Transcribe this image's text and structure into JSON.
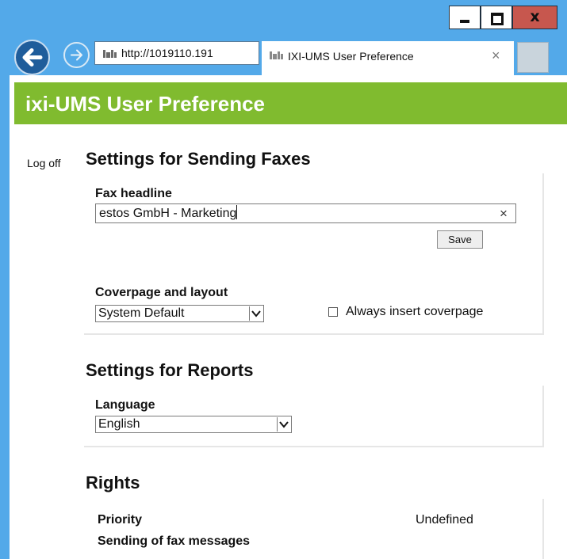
{
  "browser": {
    "address": "http://1019110.191",
    "tab_title": "IXI-UMS User Preference",
    "tab_close": "×",
    "window_close": "x"
  },
  "page": {
    "title": "ixi-UMS User Preference",
    "logoff": "Log off"
  },
  "fax_settings": {
    "title": "Settings for Sending Faxes",
    "headline_label": "Fax headline",
    "headline_value": "estos GmbH - Marketing",
    "clear_glyph": "×",
    "save_label": "Save",
    "coverpage_label": "Coverpage and layout",
    "coverpage_selected": "System Default",
    "always_insert_label": "Always insert coverpage",
    "always_insert_checked": false
  },
  "report_settings": {
    "title": "Settings for Reports",
    "language_label": "Language",
    "language_selected": "English"
  },
  "rights": {
    "title": "Rights",
    "priority_label": "Priority",
    "priority_value": "Undefined",
    "sending_label": "Sending of fax messages"
  },
  "colors": {
    "titlebar": "#53a9e9",
    "header_green": "#80bb2f",
    "close_button": "#c7574e"
  }
}
